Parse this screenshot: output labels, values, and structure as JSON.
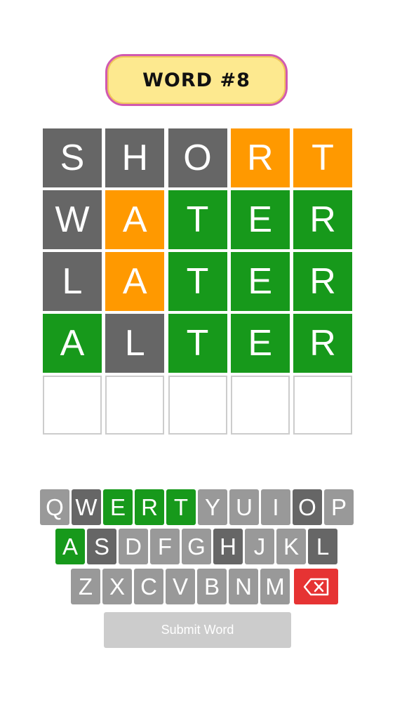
{
  "header": {
    "title": "WORD #8"
  },
  "board": {
    "rows": [
      [
        {
          "letter": "S",
          "state": "gray"
        },
        {
          "letter": "H",
          "state": "gray"
        },
        {
          "letter": "O",
          "state": "gray"
        },
        {
          "letter": "R",
          "state": "orange"
        },
        {
          "letter": "T",
          "state": "orange"
        }
      ],
      [
        {
          "letter": "W",
          "state": "gray"
        },
        {
          "letter": "A",
          "state": "orange"
        },
        {
          "letter": "T",
          "state": "green"
        },
        {
          "letter": "E",
          "state": "green"
        },
        {
          "letter": "R",
          "state": "green"
        }
      ],
      [
        {
          "letter": "L",
          "state": "gray"
        },
        {
          "letter": "A",
          "state": "orange"
        },
        {
          "letter": "T",
          "state": "green"
        },
        {
          "letter": "E",
          "state": "green"
        },
        {
          "letter": "R",
          "state": "green"
        }
      ],
      [
        {
          "letter": "A",
          "state": "green"
        },
        {
          "letter": "L",
          "state": "gray"
        },
        {
          "letter": "T",
          "state": "green"
        },
        {
          "letter": "E",
          "state": "green"
        },
        {
          "letter": "R",
          "state": "green"
        }
      ],
      [
        {
          "letter": "",
          "state": "empty"
        },
        {
          "letter": "",
          "state": "empty"
        },
        {
          "letter": "",
          "state": "empty"
        },
        {
          "letter": "",
          "state": "empty"
        },
        {
          "letter": "",
          "state": "empty"
        }
      ]
    ]
  },
  "keyboard": {
    "row1": [
      {
        "letter": "Q",
        "state": "unused"
      },
      {
        "letter": "W",
        "state": "gray"
      },
      {
        "letter": "E",
        "state": "green"
      },
      {
        "letter": "R",
        "state": "green"
      },
      {
        "letter": "T",
        "state": "green"
      },
      {
        "letter": "Y",
        "state": "unused"
      },
      {
        "letter": "U",
        "state": "unused"
      },
      {
        "letter": "I",
        "state": "unused"
      },
      {
        "letter": "O",
        "state": "gray"
      },
      {
        "letter": "P",
        "state": "unused"
      }
    ],
    "row2": [
      {
        "letter": "A",
        "state": "green"
      },
      {
        "letter": "S",
        "state": "gray"
      },
      {
        "letter": "D",
        "state": "unused"
      },
      {
        "letter": "F",
        "state": "unused"
      },
      {
        "letter": "G",
        "state": "unused"
      },
      {
        "letter": "H",
        "state": "gray"
      },
      {
        "letter": "J",
        "state": "unused"
      },
      {
        "letter": "K",
        "state": "unused"
      },
      {
        "letter": "L",
        "state": "gray"
      }
    ],
    "row3": [
      {
        "letter": "Z",
        "state": "unused"
      },
      {
        "letter": "X",
        "state": "unused"
      },
      {
        "letter": "C",
        "state": "unused"
      },
      {
        "letter": "V",
        "state": "unused"
      },
      {
        "letter": "B",
        "state": "unused"
      },
      {
        "letter": "N",
        "state": "unused"
      },
      {
        "letter": "M",
        "state": "unused"
      }
    ],
    "backspace_icon": "backspace-icon"
  },
  "submit": {
    "label": "Submit Word"
  },
  "colors": {
    "gray": "#666666",
    "orange": "#ff9900",
    "green": "#17991b",
    "unused_key": "#999999",
    "backspace": "#e63333",
    "title_bg": "#fde98f",
    "title_border": "#d15ab0"
  }
}
